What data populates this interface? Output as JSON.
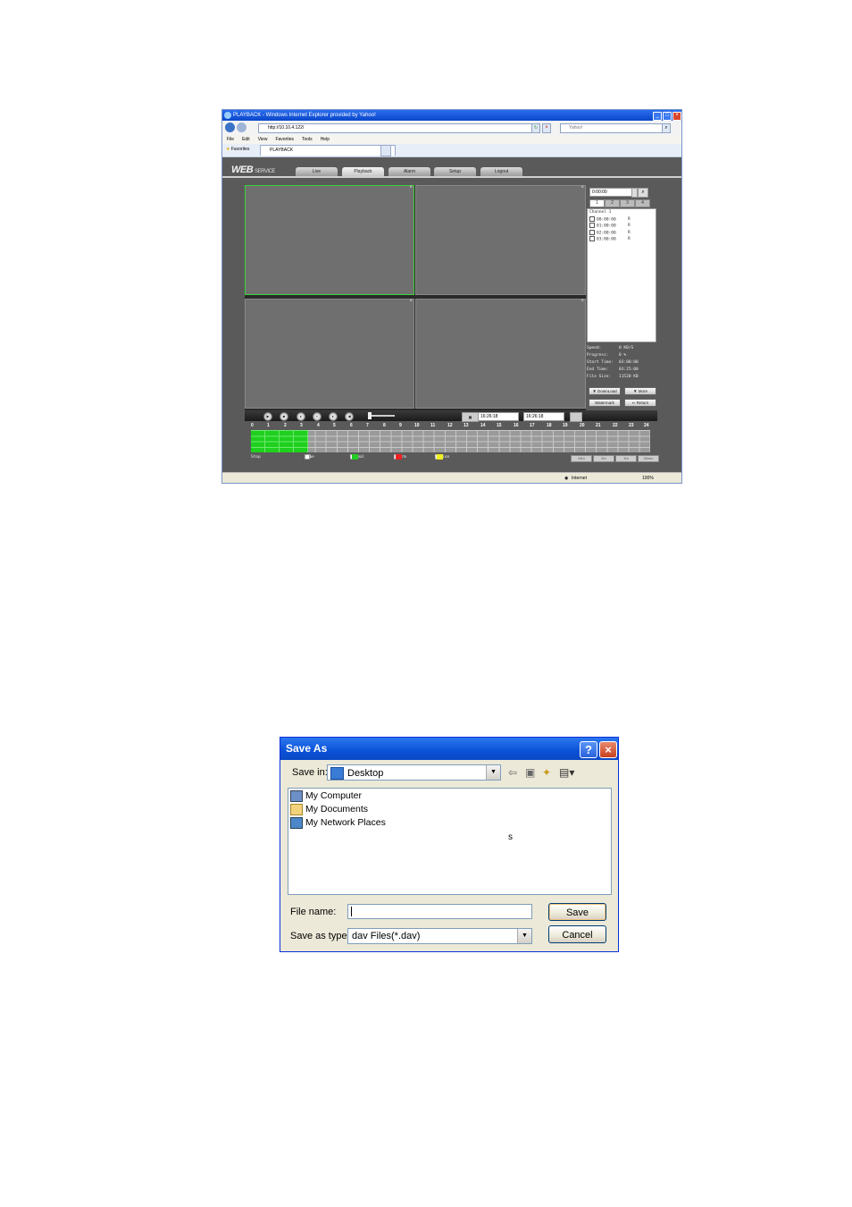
{
  "browser": {
    "title": "PLAYBACK - Windows Internet Explorer provided by Yahoo!",
    "url": "http://10.10.4.122/",
    "search_placeholder": "Yahoo!",
    "menu": [
      "File",
      "Edit",
      "View",
      "Favorites",
      "Tools",
      "Help"
    ],
    "favorites_label": "Favorites",
    "tab_label": "PLAYBACK",
    "status_zone": "Internet",
    "zoom": "100%"
  },
  "web_service": {
    "logo_main": "WEB",
    "logo_sub": "SERVICE",
    "nav": [
      "Live",
      "Playback",
      "Alarm",
      "Setup",
      "Logout"
    ],
    "active_nav": "Playback",
    "search_time": "0:00:00",
    "channel_tabs": [
      "1",
      "2",
      "3",
      "4"
    ],
    "channel_label": "Channel 1",
    "files": [
      {
        "time": "00:00:00",
        "type": "R"
      },
      {
        "time": "01:00:00",
        "type": "R"
      },
      {
        "time": "02:00:00",
        "type": "R"
      },
      {
        "time": "03:00:00",
        "type": "R"
      }
    ],
    "info": [
      {
        "key": "Speed:",
        "value": "0 KB/S"
      },
      {
        "key": "Progress:",
        "value": "0 %"
      },
      {
        "key": "Start Time:",
        "value": "03:00:00"
      },
      {
        "key": "End Time:",
        "value": "03:25:00"
      },
      {
        "key": "File Size:",
        "value": "11520 KB"
      }
    ],
    "buttons": {
      "download": "DownLoad",
      "more": "More",
      "watermark": "Watermark",
      "return": "Return"
    },
    "clip_start": "16:26:18",
    "clip_end": "16:26:18",
    "hours": [
      "0",
      "1",
      "2",
      "3",
      "4",
      "5",
      "6",
      "7",
      "8",
      "9",
      "10",
      "11",
      "12",
      "13",
      "14",
      "15",
      "16",
      "17",
      "18",
      "19",
      "20",
      "21",
      "22",
      "23",
      "24"
    ],
    "status": "Stop",
    "type_label": "Type",
    "legend": {
      "all": "all",
      "normal": "Normal",
      "alarm": "Alarm",
      "motion": "Motion"
    },
    "colors": {
      "normal": "#22cc22",
      "alarm": "#ee2222",
      "motion": "#eeee22"
    },
    "zoom_buttons": [
      "24hr",
      "2hr",
      "1hr",
      "30min"
    ]
  },
  "dialog": {
    "title": "Save As",
    "save_in_label": "Save in:",
    "save_in_value": "Desktop",
    "items": [
      "My Computer",
      "My Documents",
      "My Network Places"
    ],
    "stray_char": "s",
    "filename_label": "File name:",
    "filename_value": "",
    "type_label": "Save as type:",
    "type_value": "dav Files(*.dav)",
    "save_button": "Save",
    "cancel_button": "Cancel"
  }
}
